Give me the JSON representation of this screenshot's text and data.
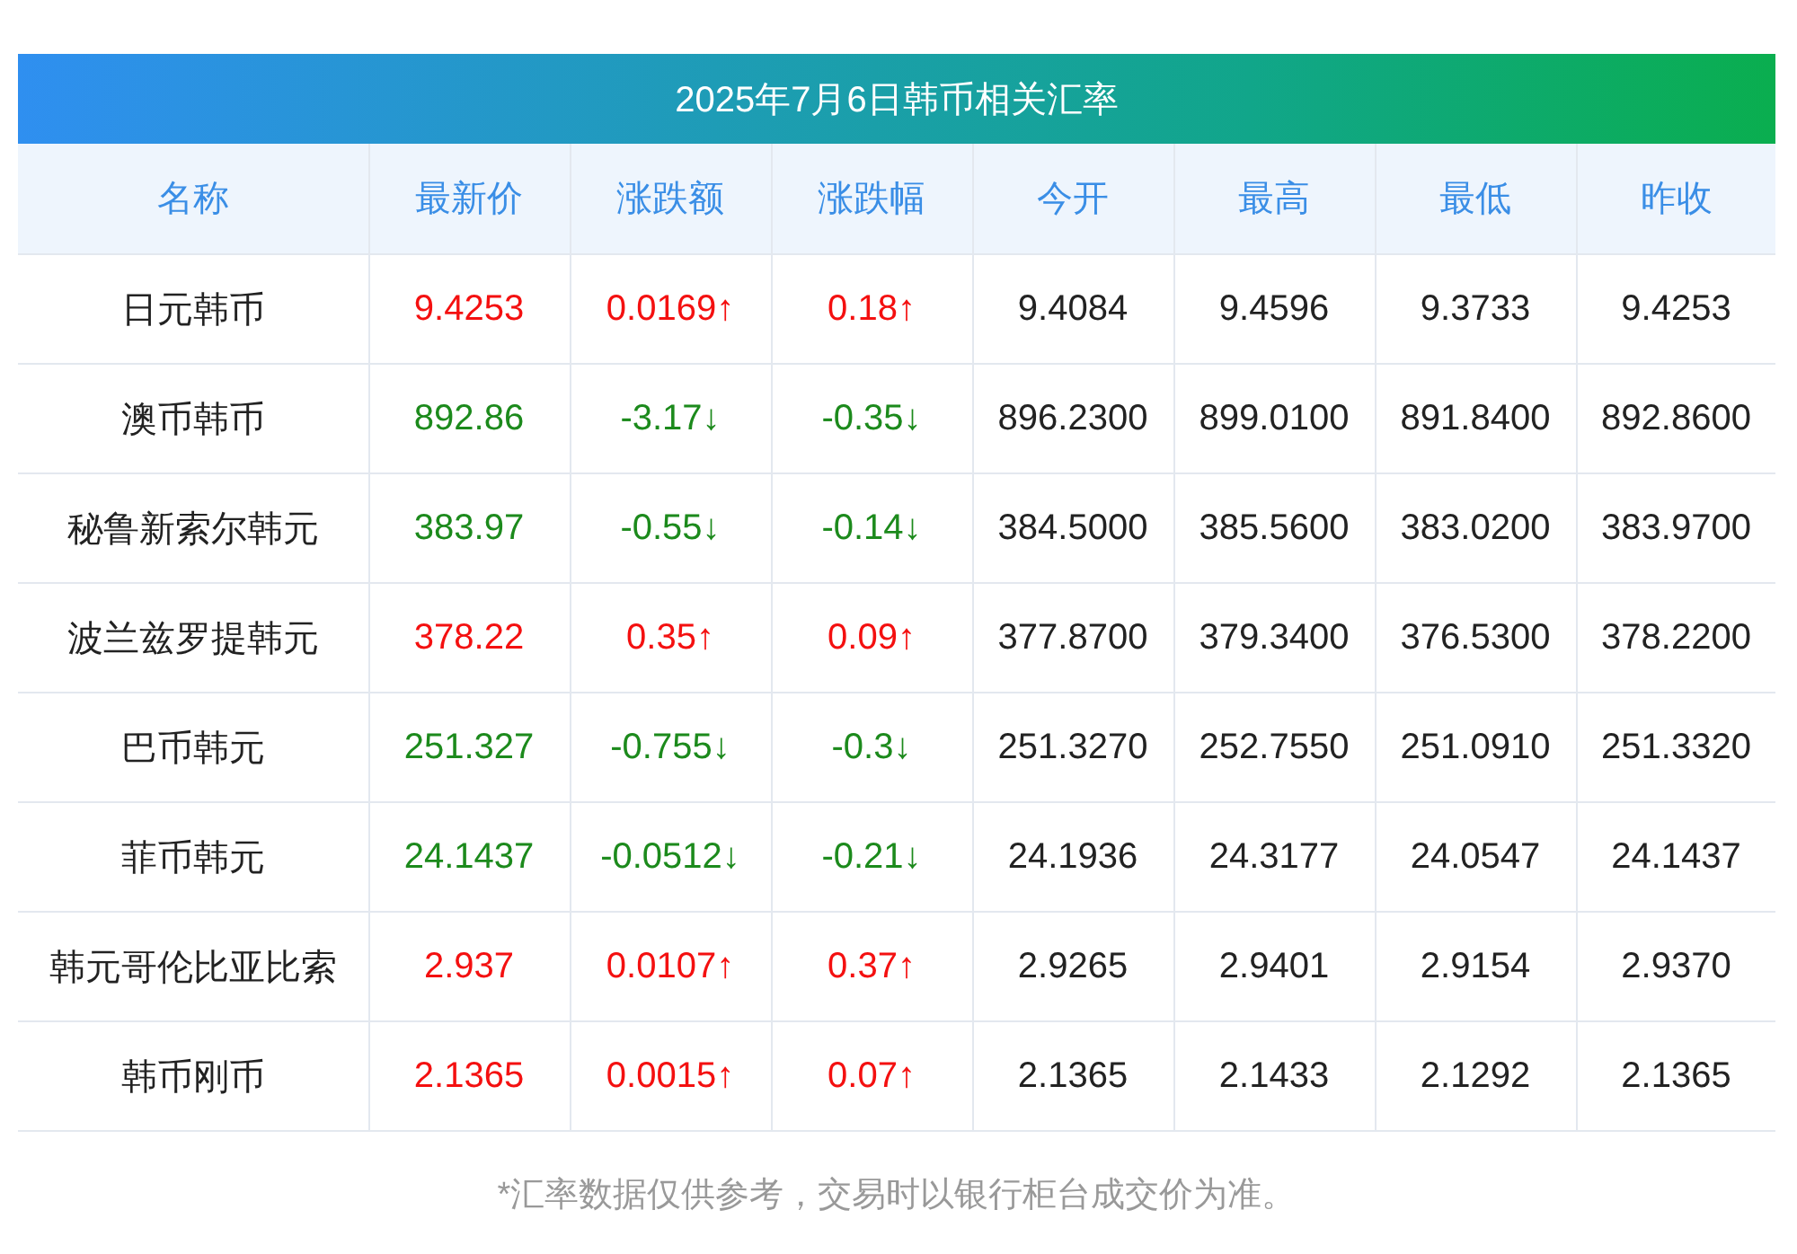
{
  "title": "2025年7月6日韩币相关汇率",
  "columns": [
    "名称",
    "最新价",
    "涨跌额",
    "涨跌幅",
    "今开",
    "最高",
    "最低",
    "昨收"
  ],
  "rows": [
    {
      "kind": "up",
      "cells": [
        "日元韩币",
        "9.4253",
        "0.0169↑",
        "0.18↑",
        "9.4084",
        "9.4596",
        "9.3733",
        "9.4253"
      ]
    },
    {
      "kind": "down",
      "cells": [
        "澳币韩币",
        "892.86",
        "-3.17↓",
        "-0.35↓",
        "896.2300",
        "899.0100",
        "891.8400",
        "892.8600"
      ]
    },
    {
      "kind": "down",
      "cells": [
        "秘鲁新索尔韩元",
        "383.97",
        "-0.55↓",
        "-0.14↓",
        "384.5000",
        "385.5600",
        "383.0200",
        "383.9700"
      ]
    },
    {
      "kind": "up",
      "cells": [
        "波兰兹罗提韩元",
        "378.22",
        "0.35↑",
        "0.09↑",
        "377.8700",
        "379.3400",
        "376.5300",
        "378.2200"
      ]
    },
    {
      "kind": "down",
      "cells": [
        "巴币韩元",
        "251.327",
        "-0.755↓",
        "-0.3↓",
        "251.3270",
        "252.7550",
        "251.0910",
        "251.3320"
      ]
    },
    {
      "kind": "down",
      "cells": [
        "菲币韩元",
        "24.1437",
        "-0.0512↓",
        "-0.21↓",
        "24.1936",
        "24.3177",
        "24.0547",
        "24.1437"
      ]
    },
    {
      "kind": "up",
      "cells": [
        "韩元哥伦比亚比索",
        "2.937",
        "0.0107↑",
        "0.37↑",
        "2.9265",
        "2.9401",
        "2.9154",
        "2.9370"
      ]
    },
    {
      "kind": "up",
      "cells": [
        "韩币刚币",
        "2.1365",
        "0.0015↑",
        "0.07↑",
        "2.1365",
        "2.1433",
        "2.1292",
        "2.1365"
      ]
    }
  ],
  "note": "*汇率数据仅供参考，交易时以银行柜台成交价为准。"
}
